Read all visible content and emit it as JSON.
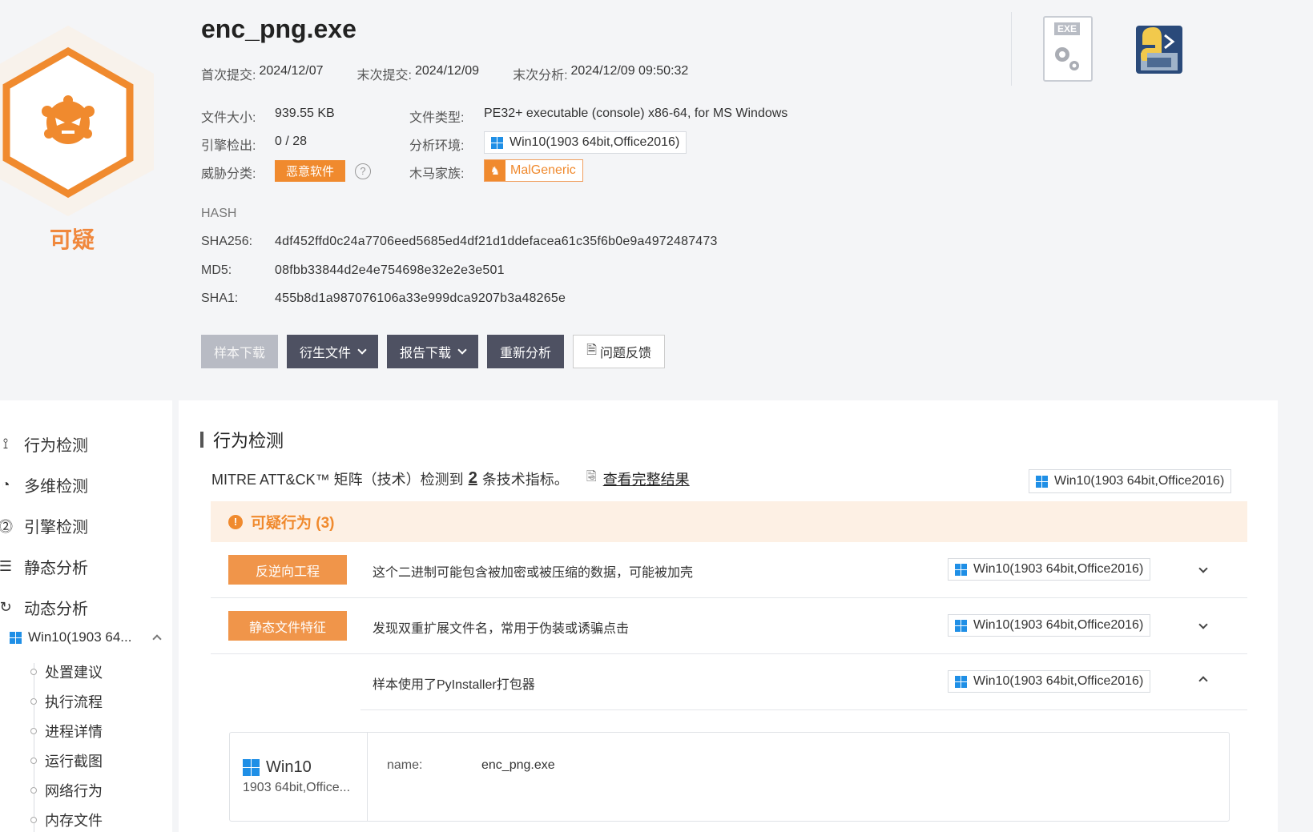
{
  "verdict": "可疑",
  "file": {
    "name": "enc_png.exe",
    "first_submit_label": "首次提交:",
    "first_submit": "2024/12/07",
    "last_submit_label": "末次提交:",
    "last_submit": "2024/12/09",
    "last_analysis_label": "末次分析:",
    "last_analysis": "2024/12/09 09:50:32",
    "size_label": "文件大小:",
    "size": "939.55 KB",
    "engine_label": "引擎检出:",
    "engine": "0 / 28",
    "threat_label": "威胁分类:",
    "threat": "恶意软件",
    "type_label": "文件类型:",
    "type": "PE32+ executable (console) x86-64, for MS Windows",
    "env_label": "分析环境:",
    "env": "Win10(1903 64bit,Office2016)",
    "family_label": "木马家族:",
    "family": "MalGeneric"
  },
  "hash": {
    "heading": "HASH",
    "sha256_label": "SHA256:",
    "sha256": "4df452ffd0c24a7706eed5685ed4df21d1ddefacea61c35f6b0e9a4972487473",
    "md5_label": "MD5:",
    "md5": "08fbb33844d2e4e754698e32e2e3e501",
    "sha1_label": "SHA1:",
    "sha1": "455b8d1a987076106a33e999dca9207b3a48265e"
  },
  "buttons": {
    "sample_download": "样本下载",
    "derived_files": "衍生文件",
    "report_download": "报告下载",
    "reanalyze": "重新分析",
    "feedback": "问题反馈"
  },
  "icons": {
    "exe_label": "EXE"
  },
  "sidebar": {
    "items": [
      {
        "label": "行为检测",
        "icon": "activity-icon"
      },
      {
        "label": "多维检测",
        "icon": "radar-icon"
      },
      {
        "label": "引擎检测",
        "icon": "engine-icon"
      },
      {
        "label": "静态分析",
        "icon": "list-icon"
      },
      {
        "label": "动态分析",
        "icon": "cycle-icon"
      }
    ],
    "env_sub": "Win10(1903 64...",
    "tree": [
      "处置建议",
      "执行流程",
      "进程详情",
      "运行截图",
      "网络行为",
      "内存文件"
    ]
  },
  "main": {
    "section_title": "行为检测",
    "mitre_prefix": "MITRE ATT&CK™ 矩阵（技术）检测到",
    "mitre_count": "2",
    "mitre_suffix": "条技术指标。",
    "mitre_link": "查看完整结果",
    "env": "Win10(1903 64bit,Office2016)",
    "warn_title": "可疑行为 (3)",
    "rows": [
      {
        "tag": "反逆向工程",
        "desc": "这个二进制可能包含被加密或被压缩的数据，可能被加壳",
        "env": "Win10(1903 64bit,Office2016)"
      },
      {
        "tag": "静态文件特征",
        "desc": "发现双重扩展文件名，常用于伪装或诱骗点击",
        "env": "Win10(1903 64bit,Office2016)"
      },
      {
        "tag": "",
        "desc": "样本使用了PyInstaller打包器",
        "env": "Win10(1903 64bit,Office2016)"
      }
    ],
    "detail": {
      "os": "Win10",
      "os_sub": "1903 64bit,Office...",
      "name_label": "name:",
      "name_value": "enc_png.exe"
    }
  },
  "colors": {
    "accent_orange": "#f08a2e",
    "dark_button": "#4e5162",
    "windows_blue": "#1f8fe6"
  }
}
